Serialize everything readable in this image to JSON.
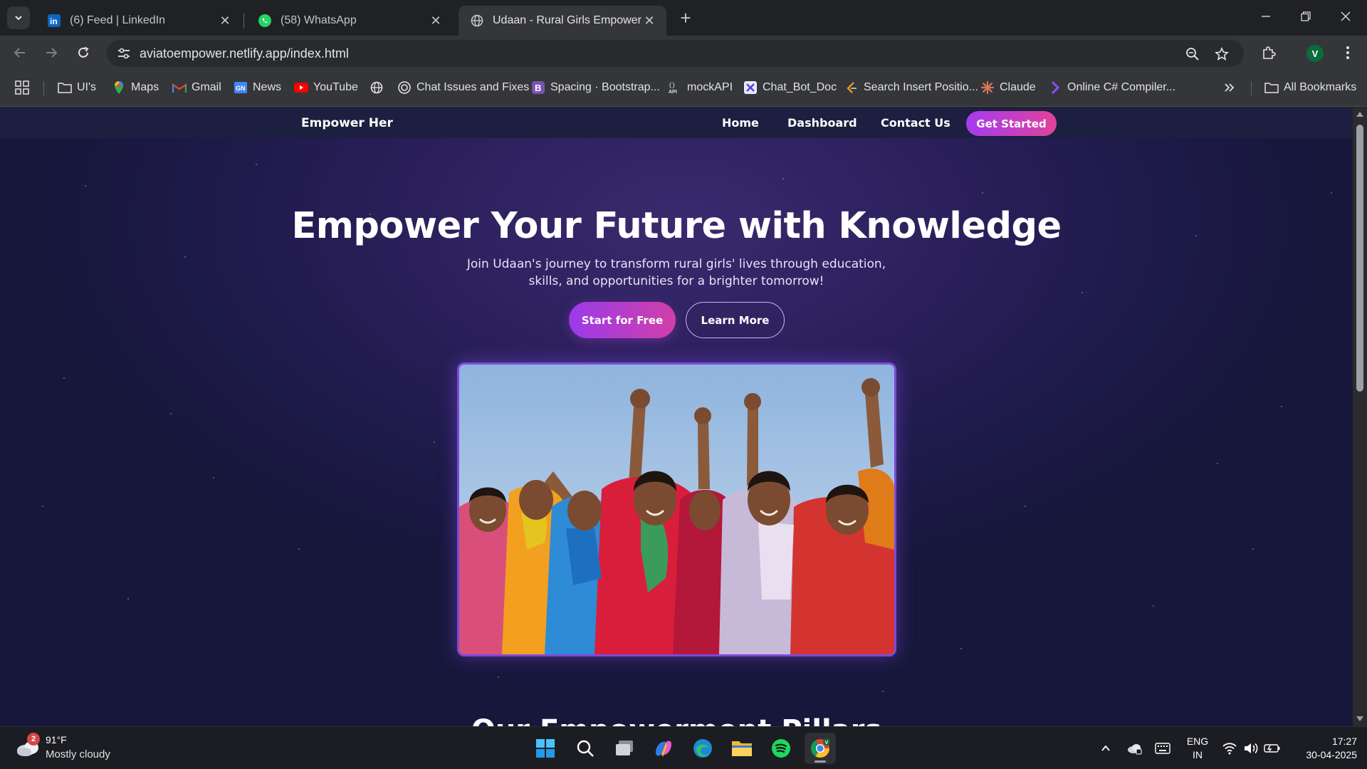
{
  "browser": {
    "tabs": [
      {
        "title": "(6) Feed | LinkedIn",
        "icon": "linkedin-icon"
      },
      {
        "title": "(58) WhatsApp",
        "icon": "whatsapp-icon"
      },
      {
        "title": "Udaan - Rural Girls Empowerme",
        "icon": "globe-icon",
        "active": true
      }
    ],
    "url": "aviatoempower.netlify.app/index.html",
    "profile_initial": "V",
    "bookmarks": [
      {
        "label": "UI's",
        "icon": "folder-icon"
      },
      {
        "label": "Maps",
        "icon": "maps-icon"
      },
      {
        "label": "Gmail",
        "icon": "gmail-icon"
      },
      {
        "label": "News",
        "icon": "news-icon"
      },
      {
        "label": "YouTube",
        "icon": "youtube-icon"
      },
      {
        "label": "",
        "icon": "globe-icon"
      },
      {
        "label": "Chat Issues and Fixes",
        "icon": "openai-icon"
      },
      {
        "label": "Spacing · Bootstrap...",
        "icon": "bootstrap-icon"
      },
      {
        "label": "mockAPI",
        "icon": "mockapi-icon"
      },
      {
        "label": "Chat_Bot_Doc",
        "icon": "puzzle-icon"
      },
      {
        "label": "Search Insert Positio...",
        "icon": "leetcode-icon"
      },
      {
        "label": "Claude",
        "icon": "claude-icon"
      },
      {
        "label": "Online C# Compiler...",
        "icon": "compiler-icon"
      }
    ],
    "all_bookmarks": "All Bookmarks"
  },
  "site": {
    "brand": "Empower Her",
    "nav": {
      "home": "Home",
      "dashboard": "Dashboard",
      "contact": "Contact Us",
      "cta": "Get Started"
    },
    "hero": {
      "title": "Empower Your Future with Knowledge",
      "subtitle": "Join Udaan's journey to transform rural girls' lives through education, skills, and opportunities for a brighter tomorrow!",
      "primary_button": "Start for Free",
      "secondary_button": "Learn More",
      "image": "group-of-rural-women-celebrating-photo"
    },
    "next_section_heading": "Our Empowerment Pillars"
  },
  "colors": {
    "accent_purple": "#a53cf0",
    "accent_pink": "#e0429a",
    "page_bg": "#231c52",
    "image_border": "#7b4ad8"
  },
  "taskbar": {
    "weather": {
      "temp": "91°F",
      "desc": "Mostly cloudy",
      "badge": "2"
    },
    "apps": [
      "windows-start-icon",
      "search-icon",
      "task-view-icon",
      "copilot-icon",
      "edge-icon",
      "file-explorer-icon",
      "spotify-icon",
      "chrome-icon"
    ],
    "language": {
      "line1": "ENG",
      "line2": "IN"
    },
    "time": "17:27",
    "date": "30-04-2025"
  }
}
